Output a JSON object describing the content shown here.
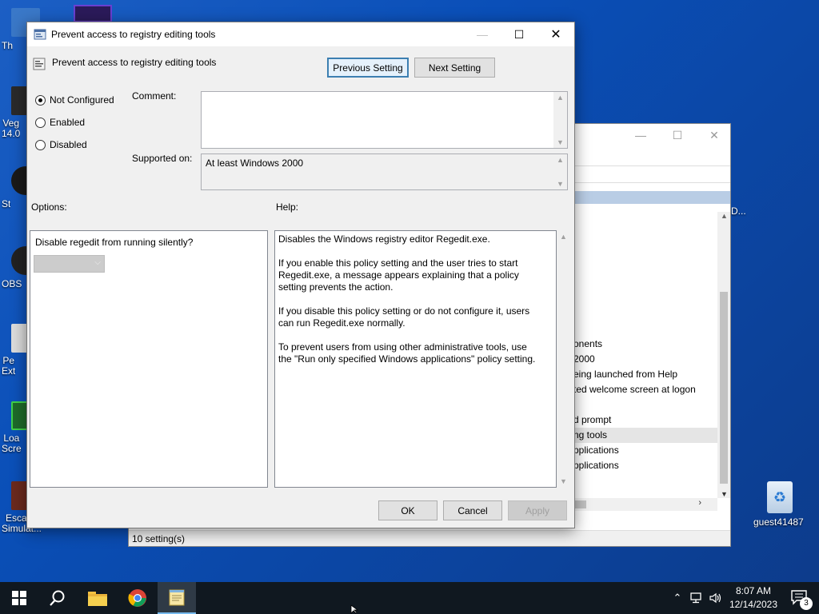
{
  "desktop": {
    "icons": [
      {
        "label": "Th",
        "color": "#3a78c8"
      },
      {
        "label": "Veg\n14.0",
        "color": "#2a2a2a"
      },
      {
        "label": "St",
        "color": "#1a1a1a"
      },
      {
        "label": "OBS",
        "color": "#222222"
      },
      {
        "label": "Pe\nExt",
        "color": "#dcdcdc"
      },
      {
        "label": "Loa\nScre",
        "color": "#1e6b2a"
      },
      {
        "label": "Escape\nSimulat...",
        "color": "#6b2a1e"
      }
    ],
    "recycle_bin_label": "guest41487",
    "back_window_edge_label": "D..."
  },
  "back_window": {
    "status": "10 setting(s)",
    "list_items": [
      "onents",
      "2000",
      "eing launched from Help",
      "ted welcome screen at logon",
      "",
      "d prompt",
      "ng tools",
      "pplications",
      "pplications"
    ],
    "selected_index": 6
  },
  "dialog": {
    "title": "Prevent access to registry editing tools",
    "policy_name": "Prevent access to registry editing tools",
    "previous_setting": "Previous Setting",
    "next_setting": "Next Setting",
    "radio_options": [
      {
        "label": "Not Configured",
        "checked": true
      },
      {
        "label": "Enabled",
        "checked": false
      },
      {
        "label": "Disabled",
        "checked": false
      }
    ],
    "comment_label": "Comment:",
    "comment_value": "",
    "supported_on_label": "Supported on:",
    "supported_on_value": "At least Windows 2000",
    "options_label": "Options:",
    "help_label": "Help:",
    "option_question": "Disable regedit from running silently?",
    "option_combo_value": "",
    "help_paragraphs": [
      "Disables the Windows registry editor Regedit.exe.",
      "If you enable this policy setting and the user tries to start Regedit.exe, a message appears explaining that a policy setting prevents the action.",
      "If you disable this policy setting or do not configure it, users can run Regedit.exe normally.",
      "To prevent users from using other administrative tools, use the \"Run only specified Windows applications\" policy setting."
    ],
    "ok": "OK",
    "cancel": "Cancel",
    "apply": "Apply"
  },
  "taskbar": {
    "time": "8:07 AM",
    "date": "12/14/2023",
    "notification_count": "3",
    "pinned": [
      "start-icon",
      "search-icon",
      "file-explorer-icon",
      "chrome-icon",
      "notepad-icon"
    ]
  }
}
